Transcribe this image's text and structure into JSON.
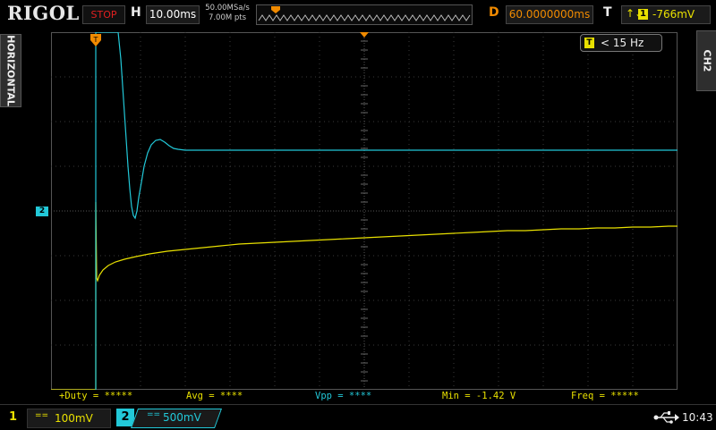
{
  "brand": "RIGOL",
  "run_state": "STOP",
  "horizontal": {
    "letter": "H",
    "timebase": "10.00ms",
    "sample_rate": "50.00MSa/s",
    "memory_depth": "7.00M pts",
    "side_tab": "HORIZONTAL"
  },
  "delay": {
    "letter": "D",
    "value": "60.0000000ms"
  },
  "trigger": {
    "letter": "T",
    "source": "1",
    "level": "-766mV",
    "edge_glyph": "↑↓"
  },
  "freq_counter": {
    "source": "T",
    "text": "< 15 Hz"
  },
  "side_tab_right": "CH2",
  "measurements": {
    "duty": "+Duty = *****",
    "avg": "Avg = ****",
    "vpp": "Vpp = ****",
    "min": "Min = -1.42 V",
    "freq": "Freq = *****"
  },
  "channels": {
    "ch1": {
      "number": "1",
      "scale": "100mV",
      "coupling": "=="
    },
    "ch2": {
      "number": "2",
      "scale": "500mV",
      "coupling": "=="
    }
  },
  "ch2_marker": "2",
  "clock": "10:43",
  "colors": {
    "ch1": "#e8e000",
    "ch2": "#22c8d8",
    "trigger_marker": "#f08a00",
    "stop": "#e02020"
  },
  "icons": {
    "usb": "usb-icon",
    "trigger_position": "trigger-position-marker-icon"
  }
}
